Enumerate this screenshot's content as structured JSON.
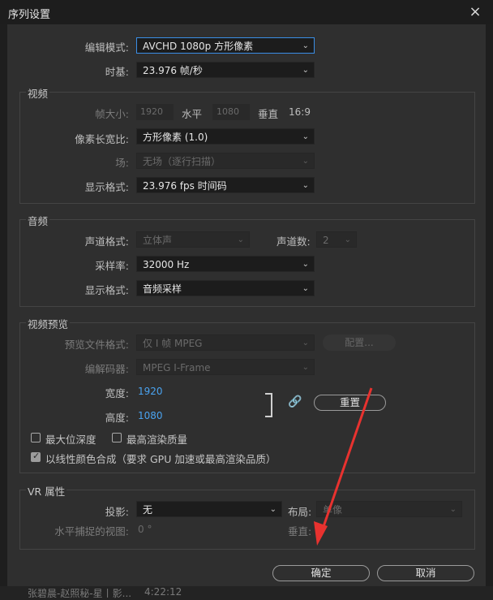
{
  "dialog": {
    "title": "序列设置",
    "close_icon": "×"
  },
  "top": {
    "edit_mode_label": "编辑模式:",
    "edit_mode_value": "AVCHD 1080p 方形像素",
    "timebase_label": "时基:",
    "timebase_value": "23.976  帧/秒"
  },
  "video": {
    "title": "视频",
    "frame_size_label": "帧大小:",
    "frame_width": "1920",
    "horizontal_label": "水平",
    "frame_height": "1080",
    "vertical_label": "垂直",
    "aspect": "16:9",
    "pixel_aspect_label": "像素长宽比:",
    "pixel_aspect_value": "方形像素 (1.0)",
    "fields_label": "场:",
    "fields_value": "无场（逐行扫描）",
    "display_format_label": "显示格式:",
    "display_format_value": "23.976 fps 时间码"
  },
  "audio": {
    "title": "音频",
    "channel_format_label": "声道格式:",
    "channel_format_value": "立体声",
    "channels_label": "声道数:",
    "channels_value": "2",
    "sample_rate_label": "采样率:",
    "sample_rate_value": "32000 Hz",
    "display_format_label": "显示格式:",
    "display_format_value": "音频采样"
  },
  "preview": {
    "title": "视频预览",
    "file_format_label": "预览文件格式:",
    "file_format_value": "仅 I 帧 MPEG",
    "configure_label": "配置...",
    "codec_label": "编解码器:",
    "codec_value": "MPEG I-Frame",
    "width_label": "宽度:",
    "width_value": "1920",
    "height_label": "高度:",
    "height_value": "1080",
    "reset_label": "重置",
    "max_depth_label": "最大位深度",
    "max_quality_label": "最高渲染质量",
    "linear_color_label": "以线性颜色合成（要求 GPU 加速或最高渲染品质）"
  },
  "vr": {
    "title": "VR 属性",
    "projection_label": "投影:",
    "projection_value": "无",
    "layout_label": "布局:",
    "layout_value": "单像",
    "horizontal_view_label": "水平捕捉的视图:",
    "horizontal_view_value": "0 °",
    "vertical_label": "垂直:"
  },
  "buttons": {
    "ok": "确定",
    "cancel": "取消"
  },
  "background": {
    "bottom_text_1": "张碧晨-赵照秘-星丨影...",
    "bottom_text_2": "4:22:12"
  },
  "colors": {
    "accent": "#3a8ee6",
    "value_blue": "#4aa3f0",
    "annotation_arrow": "#e8322f"
  }
}
